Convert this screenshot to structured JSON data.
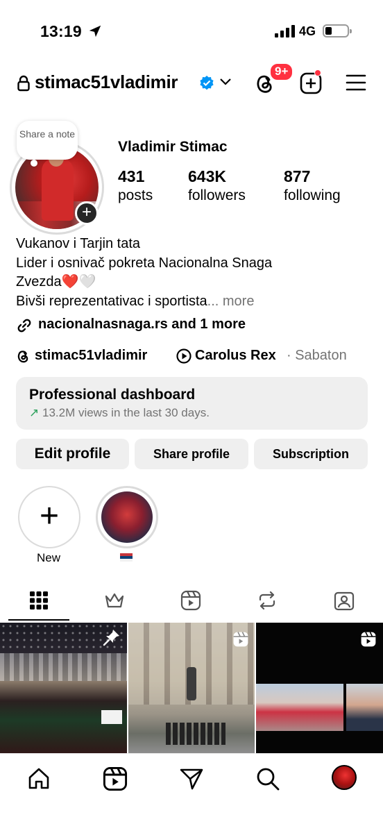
{
  "status_bar": {
    "time": "13:19",
    "network": "4G"
  },
  "header": {
    "username": "stimac51vladimir",
    "threads_badge": "9+"
  },
  "profile": {
    "note_text": "Share a note",
    "full_name": "Vladimir Stimac",
    "stats": [
      {
        "value": "431",
        "label": "posts"
      },
      {
        "value": "643K",
        "label": "followers"
      },
      {
        "value": "877",
        "label": "following"
      }
    ],
    "bio": {
      "line1": "Vukanov i Tarjin tata",
      "line2": "Lider i osnivač pokreta Nacionalna Snaga",
      "line3": "Zvezda❤️🤍",
      "line4": "Bivši reprezentativac i sportista",
      "more": "... more"
    },
    "link": "nacionalnasnaga.rs and 1 more",
    "threads_handle": "stimac51vladimir",
    "song": "Carolus Rex",
    "artist": "· Sabaton"
  },
  "dashboard": {
    "title": "Professional dashboard",
    "subtitle_arrow": "↗",
    "subtitle": "13.2M views in the last 30 days."
  },
  "buttons": {
    "edit": "Edit profile",
    "share": "Share profile",
    "subscription": "Subscription"
  },
  "highlights": [
    {
      "label": "New"
    },
    {
      "label": "🇷🇸"
    }
  ],
  "icons": {
    "tabs": [
      "grid-icon",
      "crown-icon",
      "reels-icon",
      "repost-icon",
      "tagged-icon"
    ],
    "bottom_nav": [
      "home-icon",
      "reels-icon",
      "send-icon",
      "search-icon",
      "profile-avatar"
    ]
  },
  "colors": {
    "badge": "#ff3040",
    "verified": "#0095f6",
    "trend": "#2aa05a"
  }
}
